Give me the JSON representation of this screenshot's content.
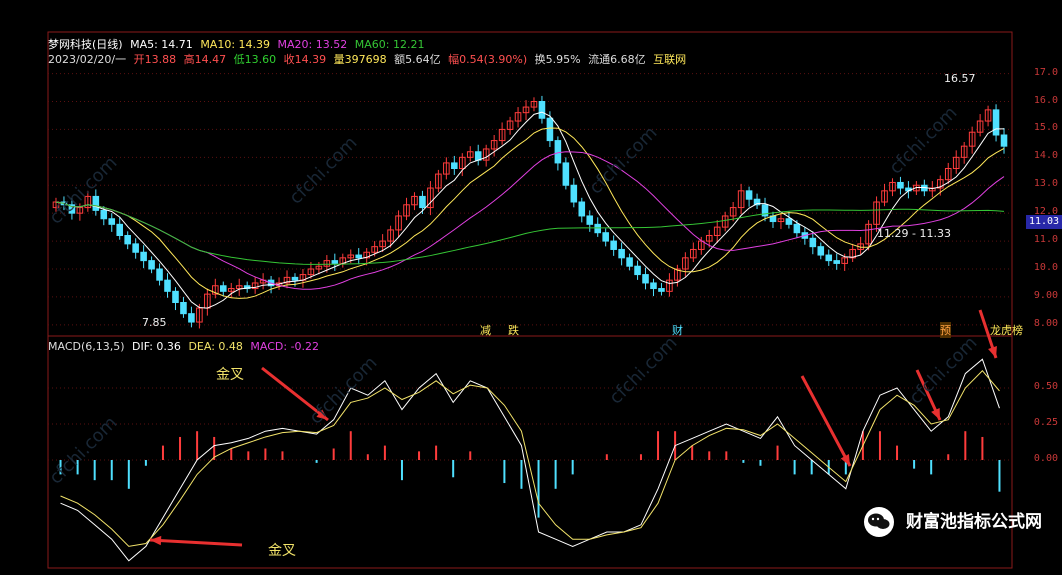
{
  "header": {
    "stock_name": "梦网科技(日线)",
    "ma5": "MA5: 14.71",
    "ma10": "MA10: 14.39",
    "ma20": "MA20: 13.52",
    "ma60": "MA60: 12.21",
    "info_date": "2023/02/20/一",
    "info_open": "开13.88",
    "info_high": "高14.47",
    "info_low": "低13.60",
    "info_close": "收14.39",
    "info_vol": "量397698",
    "info_amount": "额5.64亿",
    "info_range": "幅0.54(3.90%)",
    "info_turnover": "换5.95%",
    "info_float": "流通6.68亿",
    "info_source": "互联网"
  },
  "macd_header": {
    "name": "MACD(6,13,5)",
    "dif": "DIF: 0.36",
    "dea": "DEA: 0.48",
    "macd": "MACD: -0.22"
  },
  "price_axis": [
    "17.0",
    "16.0",
    "15.0",
    "14.0",
    "13.0",
    "12.0",
    "11.0",
    "10.0",
    "9.00",
    "8.00"
  ],
  "macd_axis": [
    "0.50",
    "0.25",
    "0.00"
  ],
  "current_price": "11.03",
  "annotations": {
    "high_label": "16.57",
    "low_label": "7.85",
    "range_label": "11.29 - 11.33"
  },
  "events": [
    "减",
    "跌",
    "财",
    "预",
    "龙虎榜"
  ],
  "golden_cross_labels": [
    "金叉",
    "金叉"
  ],
  "watermark": "cfchi.com",
  "brand": "财富池指标公式网",
  "colors": {
    "up": "#ff3c3c",
    "down": "#4fe0ff",
    "ma5": "#ffffff",
    "ma10": "#ffe85a",
    "ma20": "#e040e0",
    "ma60": "#35c535",
    "dif": "#ffffff",
    "dea": "#f2e36a",
    "grid": "#5a1010",
    "pane_border": "#8a1a1a"
  },
  "chart_data": [
    {
      "type": "candlestick",
      "title": "梦网科技(日线)",
      "ylim": [
        7.6,
        17.2
      ],
      "close_series": [
        12.4,
        12.3,
        12.0,
        12.2,
        12.6,
        12.1,
        11.8,
        11.6,
        11.2,
        10.9,
        10.6,
        10.3,
        10.0,
        9.6,
        9.2,
        8.8,
        8.4,
        8.1,
        8.6,
        9.1,
        9.4,
        9.2,
        9.3,
        9.4,
        9.3,
        9.5,
        9.6,
        9.4,
        9.5,
        9.7,
        9.6,
        9.8,
        10.0,
        10.1,
        10.3,
        10.2,
        10.4,
        10.5,
        10.4,
        10.6,
        10.8,
        11.0,
        11.4,
        11.9,
        12.3,
        12.6,
        12.2,
        12.9,
        13.4,
        13.8,
        13.6,
        14.0,
        14.2,
        13.9,
        14.3,
        14.6,
        15.0,
        15.3,
        15.6,
        15.8,
        16.0,
        15.4,
        14.6,
        13.8,
        13.0,
        12.4,
        11.9,
        11.6,
        11.3,
        11.0,
        10.7,
        10.4,
        10.1,
        9.8,
        9.5,
        9.3,
        9.2,
        9.6,
        10.0,
        10.4,
        10.7,
        11.0,
        11.2,
        11.5,
        11.9,
        12.2,
        12.8,
        12.5,
        12.3,
        11.9,
        11.7,
        11.8,
        11.6,
        11.3,
        11.1,
        10.8,
        10.5,
        10.3,
        10.2,
        10.4,
        10.7,
        10.9,
        11.6,
        12.4,
        12.8,
        13.1,
        12.9,
        12.8,
        13.0,
        12.8,
        12.9,
        13.2,
        13.6,
        14.0,
        14.4,
        14.9,
        15.3,
        15.7,
        14.8,
        14.4
      ],
      "ma_values_last": {
        "MA5": 14.71,
        "MA10": 14.39,
        "MA20": 13.52,
        "MA60": 12.21
      },
      "annotated_high": 16.57,
      "annotated_low": 7.85,
      "current_price": 11.03
    },
    {
      "type": "line",
      "title": "MACD(6,13,5)",
      "ylim": [
        -0.75,
        0.75
      ],
      "series": [
        {
          "name": "DIF",
          "values": [
            -0.3,
            -0.35,
            -0.45,
            -0.55,
            -0.7,
            -0.6,
            -0.4,
            -0.2,
            0.0,
            0.1,
            0.12,
            0.15,
            0.2,
            0.22,
            0.2,
            0.18,
            0.28,
            0.5,
            0.45,
            0.55,
            0.35,
            0.5,
            0.6,
            0.4,
            0.55,
            0.5,
            0.3,
            0.1,
            -0.5,
            -0.55,
            -0.6,
            -0.55,
            -0.5,
            -0.5,
            -0.45,
            -0.2,
            0.1,
            0.15,
            0.2,
            0.25,
            0.2,
            0.15,
            0.3,
            0.1,
            0.0,
            -0.1,
            -0.2,
            0.2,
            0.45,
            0.5,
            0.35,
            0.2,
            0.3,
            0.6,
            0.7,
            0.36
          ]
        },
        {
          "name": "DEA",
          "values": [
            -0.25,
            -0.3,
            -0.38,
            -0.48,
            -0.6,
            -0.58,
            -0.45,
            -0.28,
            -0.1,
            0.02,
            0.08,
            0.12,
            0.16,
            0.19,
            0.2,
            0.19,
            0.24,
            0.4,
            0.43,
            0.5,
            0.42,
            0.47,
            0.55,
            0.46,
            0.52,
            0.5,
            0.38,
            0.2,
            -0.3,
            -0.45,
            -0.55,
            -0.55,
            -0.52,
            -0.5,
            -0.47,
            -0.3,
            0.0,
            0.1,
            0.17,
            0.22,
            0.21,
            0.17,
            0.25,
            0.15,
            0.05,
            -0.05,
            -0.15,
            0.1,
            0.35,
            0.45,
            0.38,
            0.25,
            0.28,
            0.5,
            0.62,
            0.48
          ]
        },
        {
          "name": "MACD",
          "values": [
            -0.1,
            -0.1,
            -0.14,
            -0.14,
            -0.2,
            -0.04,
            0.1,
            0.16,
            0.2,
            0.16,
            0.08,
            0.06,
            0.08,
            0.06,
            0.0,
            -0.02,
            0.08,
            0.2,
            0.04,
            0.1,
            -0.14,
            0.06,
            0.1,
            -0.12,
            0.06,
            0.0,
            -0.16,
            -0.2,
            -0.4,
            -0.2,
            -0.1,
            0.0,
            0.04,
            0.0,
            0.04,
            0.2,
            0.2,
            0.1,
            0.06,
            0.06,
            -0.02,
            -0.04,
            0.1,
            -0.1,
            -0.1,
            -0.1,
            -0.1,
            0.2,
            0.2,
            0.1,
            -0.06,
            -0.1,
            0.04,
            0.2,
            0.16,
            -0.22
          ]
        }
      ],
      "values_last": {
        "DIF": 0.36,
        "DEA": 0.48,
        "MACD": -0.22
      }
    }
  ]
}
